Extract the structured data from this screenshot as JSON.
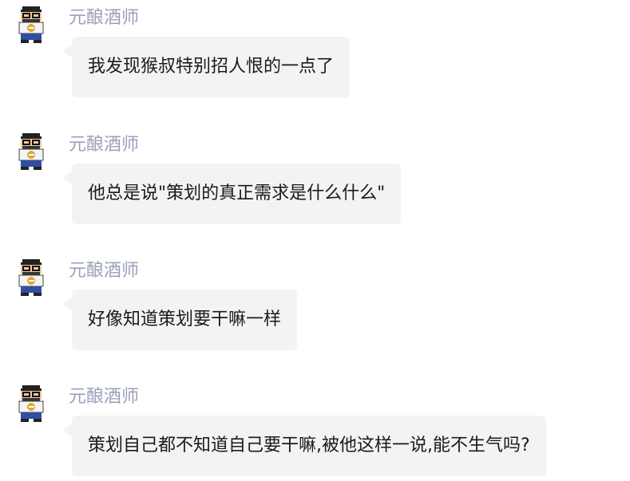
{
  "chat": {
    "messages": [
      {
        "sender": "元酿酒师",
        "text": "我发现猴叔特别招人恨的一点了",
        "avatar": "pixel-avatar-icon"
      },
      {
        "sender": "元酿酒师",
        "text": "他总是说\"策划的真正需求是什么什么\"",
        "avatar": "pixel-avatar-icon"
      },
      {
        "sender": "元酿酒师",
        "text": "好像知道策划要干嘛一样",
        "avatar": "pixel-avatar-icon"
      },
      {
        "sender": "元酿酒师",
        "text": "策划自己都不知道自己要干嘛,被他这样一说,能不生气吗?",
        "avatar": "pixel-avatar-icon"
      }
    ]
  },
  "colors": {
    "sender_name": "#9aa0b8",
    "bubble_bg": "#f3f3f3",
    "text": "#1a1a1a"
  }
}
